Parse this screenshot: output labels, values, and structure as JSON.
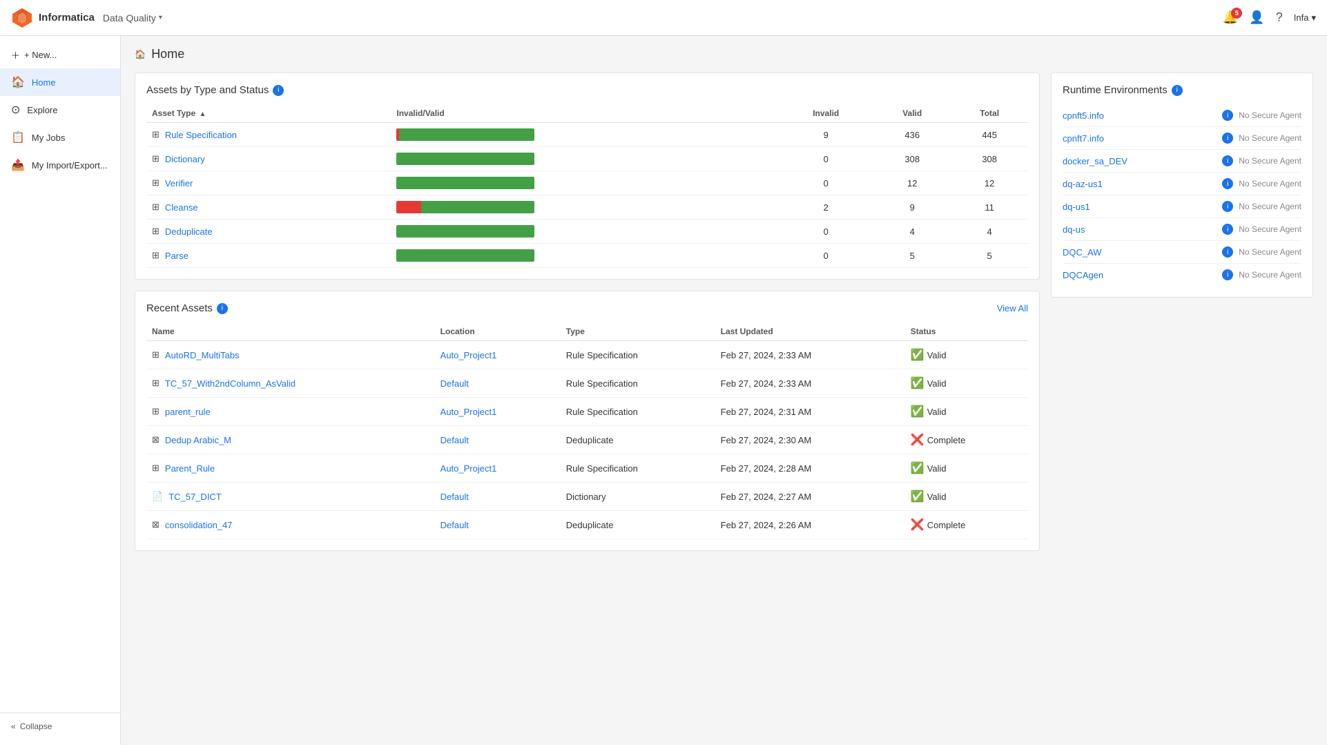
{
  "app": {
    "logo_text": "Informatica",
    "product": "Data Quality",
    "user": "Infa",
    "badge_count": "5"
  },
  "sidebar": {
    "new_label": "+ New...",
    "items": [
      {
        "id": "home",
        "label": "Home",
        "icon": "🏠",
        "active": true
      },
      {
        "id": "explore",
        "label": "Explore",
        "icon": "⊙"
      },
      {
        "id": "my-jobs",
        "label": "My Jobs",
        "icon": "📋"
      },
      {
        "id": "my-import-export",
        "label": "My Import/Export...",
        "icon": "📤"
      }
    ],
    "collapse_label": "Collapse"
  },
  "page": {
    "title": "Home"
  },
  "assets_by_type": {
    "title": "Assets by Type and Status",
    "columns": {
      "asset_type": "Asset Type",
      "invalid_valid": "Invalid/Valid",
      "invalid": "Invalid",
      "valid": "Valid",
      "total": "Total"
    },
    "rows": [
      {
        "name": "Rule Specification",
        "invalid": 9,
        "valid": 436,
        "total": 445,
        "red_pct": 2,
        "green_pct": 98
      },
      {
        "name": "Dictionary",
        "invalid": 0,
        "valid": 308,
        "total": 308,
        "red_pct": 0,
        "green_pct": 100
      },
      {
        "name": "Verifier",
        "invalid": 0,
        "valid": 12,
        "total": 12,
        "red_pct": 0,
        "green_pct": 100
      },
      {
        "name": "Cleanse",
        "invalid": 2,
        "valid": 9,
        "total": 11,
        "red_pct": 18,
        "green_pct": 82
      },
      {
        "name": "Deduplicate",
        "invalid": 0,
        "valid": 4,
        "total": 4,
        "red_pct": 0,
        "green_pct": 100
      },
      {
        "name": "Parse",
        "invalid": 0,
        "valid": 5,
        "total": 5,
        "red_pct": 0,
        "green_pct": 100
      }
    ]
  },
  "runtime_environments": {
    "title": "Runtime Environments",
    "items": [
      {
        "name": "cpnft5.info",
        "status": "No Secure Agent"
      },
      {
        "name": "cpnft7.info",
        "status": "No Secure Agent"
      },
      {
        "name": "docker_sa_DEV",
        "status": "No Secure Agent"
      },
      {
        "name": "dq-az-us1",
        "status": "No Secure Agent"
      },
      {
        "name": "dq-us1",
        "status": "No Secure Agent"
      },
      {
        "name": "dq-us",
        "status": "No Secure Agent"
      },
      {
        "name": "DQC_AW",
        "status": "No Secure Agent"
      },
      {
        "name": "DQCAgen",
        "status": "No Secure Agent"
      }
    ]
  },
  "recent_assets": {
    "title": "Recent Assets",
    "view_all": "View All",
    "columns": {
      "name": "Name",
      "location": "Location",
      "type": "Type",
      "last_updated": "Last Updated",
      "status": "Status"
    },
    "rows": [
      {
        "name": "AutoRD_MultiTabs",
        "location": "Auto_Project1",
        "type": "Rule Specification",
        "last_updated": "Feb 27, 2024, 2:33 AM",
        "status": "Valid",
        "status_type": "valid"
      },
      {
        "name": "TC_57_With2ndColumn_AsValid",
        "location": "Default",
        "type": "Rule Specification",
        "last_updated": "Feb 27, 2024, 2:33 AM",
        "status": "Valid",
        "status_type": "valid"
      },
      {
        "name": "parent_rule",
        "location": "Auto_Project1",
        "type": "Rule Specification",
        "last_updated": "Feb 27, 2024, 2:31 AM",
        "status": "Valid",
        "status_type": "valid"
      },
      {
        "name": "Dedup Arabic_M",
        "location": "Default",
        "type": "Deduplicate",
        "last_updated": "Feb 27, 2024, 2:30 AM",
        "status": "Complete",
        "status_type": "complete"
      },
      {
        "name": "Parent_Rule",
        "location": "Auto_Project1",
        "type": "Rule Specification",
        "last_updated": "Feb 27, 2024, 2:28 AM",
        "status": "Valid",
        "status_type": "valid"
      },
      {
        "name": "TC_57_DICT",
        "location": "Default",
        "type": "Dictionary",
        "last_updated": "Feb 27, 2024, 2:27 AM",
        "status": "Valid",
        "status_type": "valid"
      },
      {
        "name": "consolidation_47",
        "location": "Default",
        "type": "Deduplicate",
        "last_updated": "Feb 27, 2024, 2:26 AM",
        "status": "Complete",
        "status_type": "complete"
      }
    ]
  }
}
